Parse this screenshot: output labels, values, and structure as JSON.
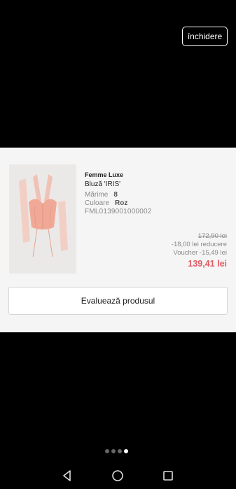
{
  "header": {
    "close_label": "închidere"
  },
  "product": {
    "brand": "Femme Luxe",
    "name": "Bluză 'IRIS'",
    "size_label": "Mărime",
    "size_value": "8",
    "color_label": "Culoare",
    "color_value": "Roz",
    "sku": "FML0139001000002",
    "image_icon": "product-photo-pink-corset-top"
  },
  "pricing": {
    "original_price": "172,90 lei",
    "discount": "-18,00 lei reducere",
    "voucher": "Voucher -15,49 lei",
    "final_price": "139,41 lei",
    "final_price_color": "#e05a63"
  },
  "actions": {
    "rate_label": "Evaluează produsul"
  },
  "pager": {
    "count": 4,
    "active_index": 3
  },
  "system_nav": {
    "icons": [
      "back-icon",
      "home-icon",
      "recents-icon"
    ]
  }
}
